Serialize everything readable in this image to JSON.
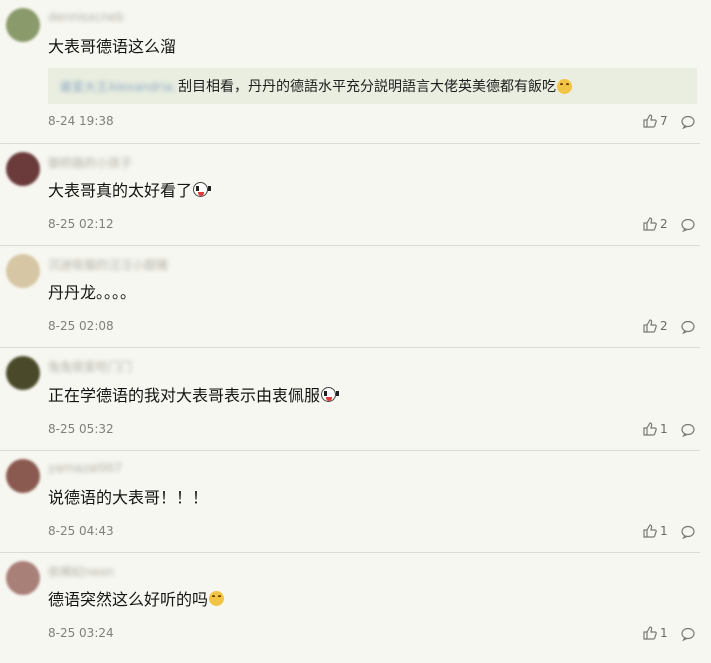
{
  "comments": [
    {
      "username": "dennisxcneb",
      "avatar_color": "#8a9a6a",
      "text": "大表哥德语这么溜",
      "emoji": "",
      "quote": {
        "user": "最爱大王Alexandria:",
        "text": "刮目相看，丹丹的德語水平充分説明語言大佬英美德都有飯吃",
        "emoji": "ecstatic"
      },
      "date": "8-24 19:38",
      "likes": "7"
    },
    {
      "username": "御府路的小孩子",
      "avatar_color": "#6b3a3a",
      "text": "大表哥真的太好看了",
      "emoji": "drool",
      "date": "8-25 02:12",
      "likes": "2"
    },
    {
      "username": "沉迷吸猫的汪汪小甜猪",
      "avatar_color": "#d6c6a4",
      "text": "丹丹龙。。。。",
      "emoji": "",
      "date": "8-25 02:08",
      "likes": "2"
    },
    {
      "username": "兔兔很爱吃门门",
      "avatar_color": "#4a4a2a",
      "text": "正在学德语的我对大表哥表示由衷佩服",
      "emoji": "drool",
      "date": "8-25 05:32",
      "likes": "1"
    },
    {
      "username": "yarnazal007",
      "avatar_color": "#8a5a50",
      "text": "说德语的大表哥！！！",
      "emoji": "",
      "date": "8-25 04:43",
      "likes": "1"
    },
    {
      "username": "依稀纪neon",
      "avatar_color": "#a88078",
      "text": "德语突然这么好听的吗",
      "emoji": "ecstatic",
      "date": "8-25 03:24",
      "likes": "1"
    }
  ]
}
